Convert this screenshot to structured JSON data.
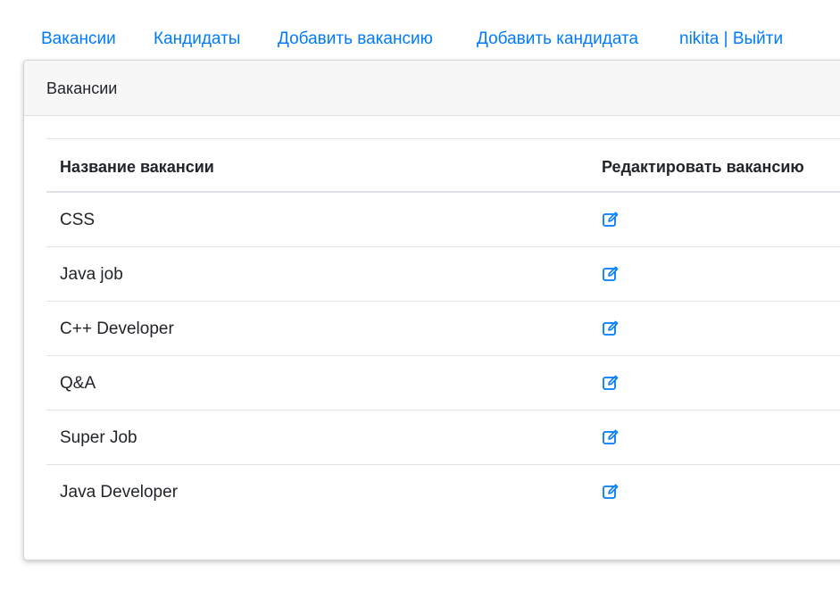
{
  "nav": {
    "items": [
      {
        "label": "Вакансии"
      },
      {
        "label": "Кандидаты"
      },
      {
        "label": "Добавить вакансию"
      },
      {
        "label": "Добавить кандидата"
      },
      {
        "label": "nikita | Выйти"
      }
    ]
  },
  "card": {
    "title": "Вакансии"
  },
  "table": {
    "headers": {
      "name": "Название вакансии",
      "edit": "Редактировать вакансию"
    },
    "rows": [
      {
        "name": "CSS"
      },
      {
        "name": "Java job"
      },
      {
        "name": "C++ Developer"
      },
      {
        "name": "Q&A"
      },
      {
        "name": "Super Job"
      },
      {
        "name": "Java Developer"
      }
    ]
  },
  "colors": {
    "link": "#007bff",
    "header_bg": "#f7f7f7",
    "border": "#dee2e6"
  },
  "icons": {
    "edit": "edit-icon"
  }
}
